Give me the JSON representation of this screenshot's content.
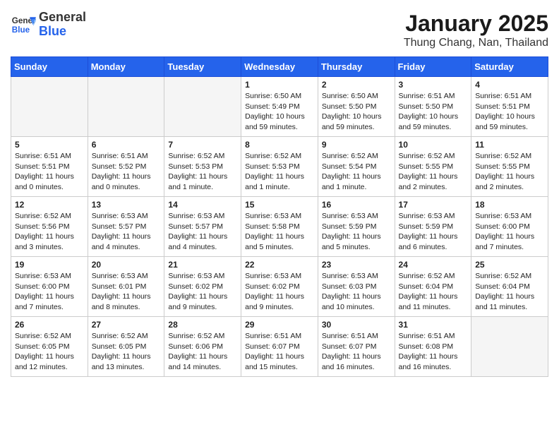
{
  "header": {
    "logo_line1": "General",
    "logo_line2": "Blue",
    "month_title": "January 2025",
    "location": "Thung Chang, Nan, Thailand"
  },
  "weekdays": [
    "Sunday",
    "Monday",
    "Tuesday",
    "Wednesday",
    "Thursday",
    "Friday",
    "Saturday"
  ],
  "weeks": [
    [
      {
        "day": "",
        "info": ""
      },
      {
        "day": "",
        "info": ""
      },
      {
        "day": "",
        "info": ""
      },
      {
        "day": "1",
        "info": "Sunrise: 6:50 AM\nSunset: 5:49 PM\nDaylight: 10 hours\nand 59 minutes."
      },
      {
        "day": "2",
        "info": "Sunrise: 6:50 AM\nSunset: 5:50 PM\nDaylight: 10 hours\nand 59 minutes."
      },
      {
        "day": "3",
        "info": "Sunrise: 6:51 AM\nSunset: 5:50 PM\nDaylight: 10 hours\nand 59 minutes."
      },
      {
        "day": "4",
        "info": "Sunrise: 6:51 AM\nSunset: 5:51 PM\nDaylight: 10 hours\nand 59 minutes."
      }
    ],
    [
      {
        "day": "5",
        "info": "Sunrise: 6:51 AM\nSunset: 5:51 PM\nDaylight: 11 hours\nand 0 minutes."
      },
      {
        "day": "6",
        "info": "Sunrise: 6:51 AM\nSunset: 5:52 PM\nDaylight: 11 hours\nand 0 minutes."
      },
      {
        "day": "7",
        "info": "Sunrise: 6:52 AM\nSunset: 5:53 PM\nDaylight: 11 hours\nand 1 minute."
      },
      {
        "day": "8",
        "info": "Sunrise: 6:52 AM\nSunset: 5:53 PM\nDaylight: 11 hours\nand 1 minute."
      },
      {
        "day": "9",
        "info": "Sunrise: 6:52 AM\nSunset: 5:54 PM\nDaylight: 11 hours\nand 1 minute."
      },
      {
        "day": "10",
        "info": "Sunrise: 6:52 AM\nSunset: 5:55 PM\nDaylight: 11 hours\nand 2 minutes."
      },
      {
        "day": "11",
        "info": "Sunrise: 6:52 AM\nSunset: 5:55 PM\nDaylight: 11 hours\nand 2 minutes."
      }
    ],
    [
      {
        "day": "12",
        "info": "Sunrise: 6:52 AM\nSunset: 5:56 PM\nDaylight: 11 hours\nand 3 minutes."
      },
      {
        "day": "13",
        "info": "Sunrise: 6:53 AM\nSunset: 5:57 PM\nDaylight: 11 hours\nand 4 minutes."
      },
      {
        "day": "14",
        "info": "Sunrise: 6:53 AM\nSunset: 5:57 PM\nDaylight: 11 hours\nand 4 minutes."
      },
      {
        "day": "15",
        "info": "Sunrise: 6:53 AM\nSunset: 5:58 PM\nDaylight: 11 hours\nand 5 minutes."
      },
      {
        "day": "16",
        "info": "Sunrise: 6:53 AM\nSunset: 5:59 PM\nDaylight: 11 hours\nand 5 minutes."
      },
      {
        "day": "17",
        "info": "Sunrise: 6:53 AM\nSunset: 5:59 PM\nDaylight: 11 hours\nand 6 minutes."
      },
      {
        "day": "18",
        "info": "Sunrise: 6:53 AM\nSunset: 6:00 PM\nDaylight: 11 hours\nand 7 minutes."
      }
    ],
    [
      {
        "day": "19",
        "info": "Sunrise: 6:53 AM\nSunset: 6:00 PM\nDaylight: 11 hours\nand 7 minutes."
      },
      {
        "day": "20",
        "info": "Sunrise: 6:53 AM\nSunset: 6:01 PM\nDaylight: 11 hours\nand 8 minutes."
      },
      {
        "day": "21",
        "info": "Sunrise: 6:53 AM\nSunset: 6:02 PM\nDaylight: 11 hours\nand 9 minutes."
      },
      {
        "day": "22",
        "info": "Sunrise: 6:53 AM\nSunset: 6:02 PM\nDaylight: 11 hours\nand 9 minutes."
      },
      {
        "day": "23",
        "info": "Sunrise: 6:53 AM\nSunset: 6:03 PM\nDaylight: 11 hours\nand 10 minutes."
      },
      {
        "day": "24",
        "info": "Sunrise: 6:52 AM\nSunset: 6:04 PM\nDaylight: 11 hours\nand 11 minutes."
      },
      {
        "day": "25",
        "info": "Sunrise: 6:52 AM\nSunset: 6:04 PM\nDaylight: 11 hours\nand 11 minutes."
      }
    ],
    [
      {
        "day": "26",
        "info": "Sunrise: 6:52 AM\nSunset: 6:05 PM\nDaylight: 11 hours\nand 12 minutes."
      },
      {
        "day": "27",
        "info": "Sunrise: 6:52 AM\nSunset: 6:05 PM\nDaylight: 11 hours\nand 13 minutes."
      },
      {
        "day": "28",
        "info": "Sunrise: 6:52 AM\nSunset: 6:06 PM\nDaylight: 11 hours\nand 14 minutes."
      },
      {
        "day": "29",
        "info": "Sunrise: 6:51 AM\nSunset: 6:07 PM\nDaylight: 11 hours\nand 15 minutes."
      },
      {
        "day": "30",
        "info": "Sunrise: 6:51 AM\nSunset: 6:07 PM\nDaylight: 11 hours\nand 16 minutes."
      },
      {
        "day": "31",
        "info": "Sunrise: 6:51 AM\nSunset: 6:08 PM\nDaylight: 11 hours\nand 16 minutes."
      },
      {
        "day": "",
        "info": ""
      }
    ]
  ]
}
